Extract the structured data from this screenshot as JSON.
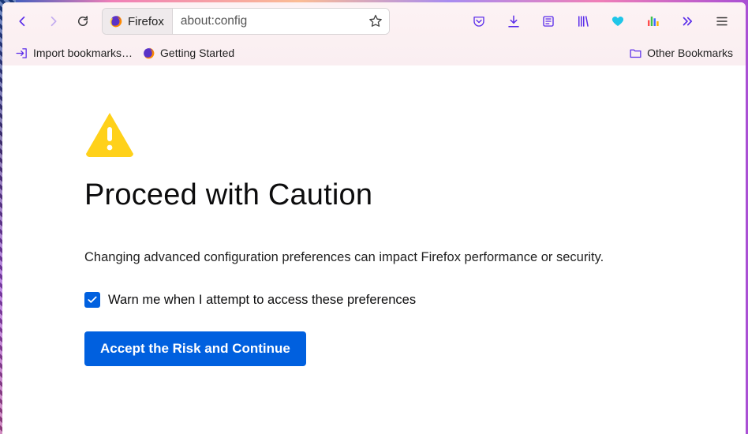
{
  "toolbar": {
    "identity_label": "Firefox",
    "url": "about:config"
  },
  "bookmarks": {
    "import_label": "Import bookmarks…",
    "getting_started_label": "Getting Started",
    "other_label": "Other Bookmarks"
  },
  "page": {
    "heading": "Proceed with Caution",
    "message": "Changing advanced configuration preferences can impact Firefox performance or security.",
    "checkbox_label": "Warn me when I attempt to access these preferences",
    "checkbox_checked": true,
    "accept_label": "Accept the Risk and Continue"
  }
}
